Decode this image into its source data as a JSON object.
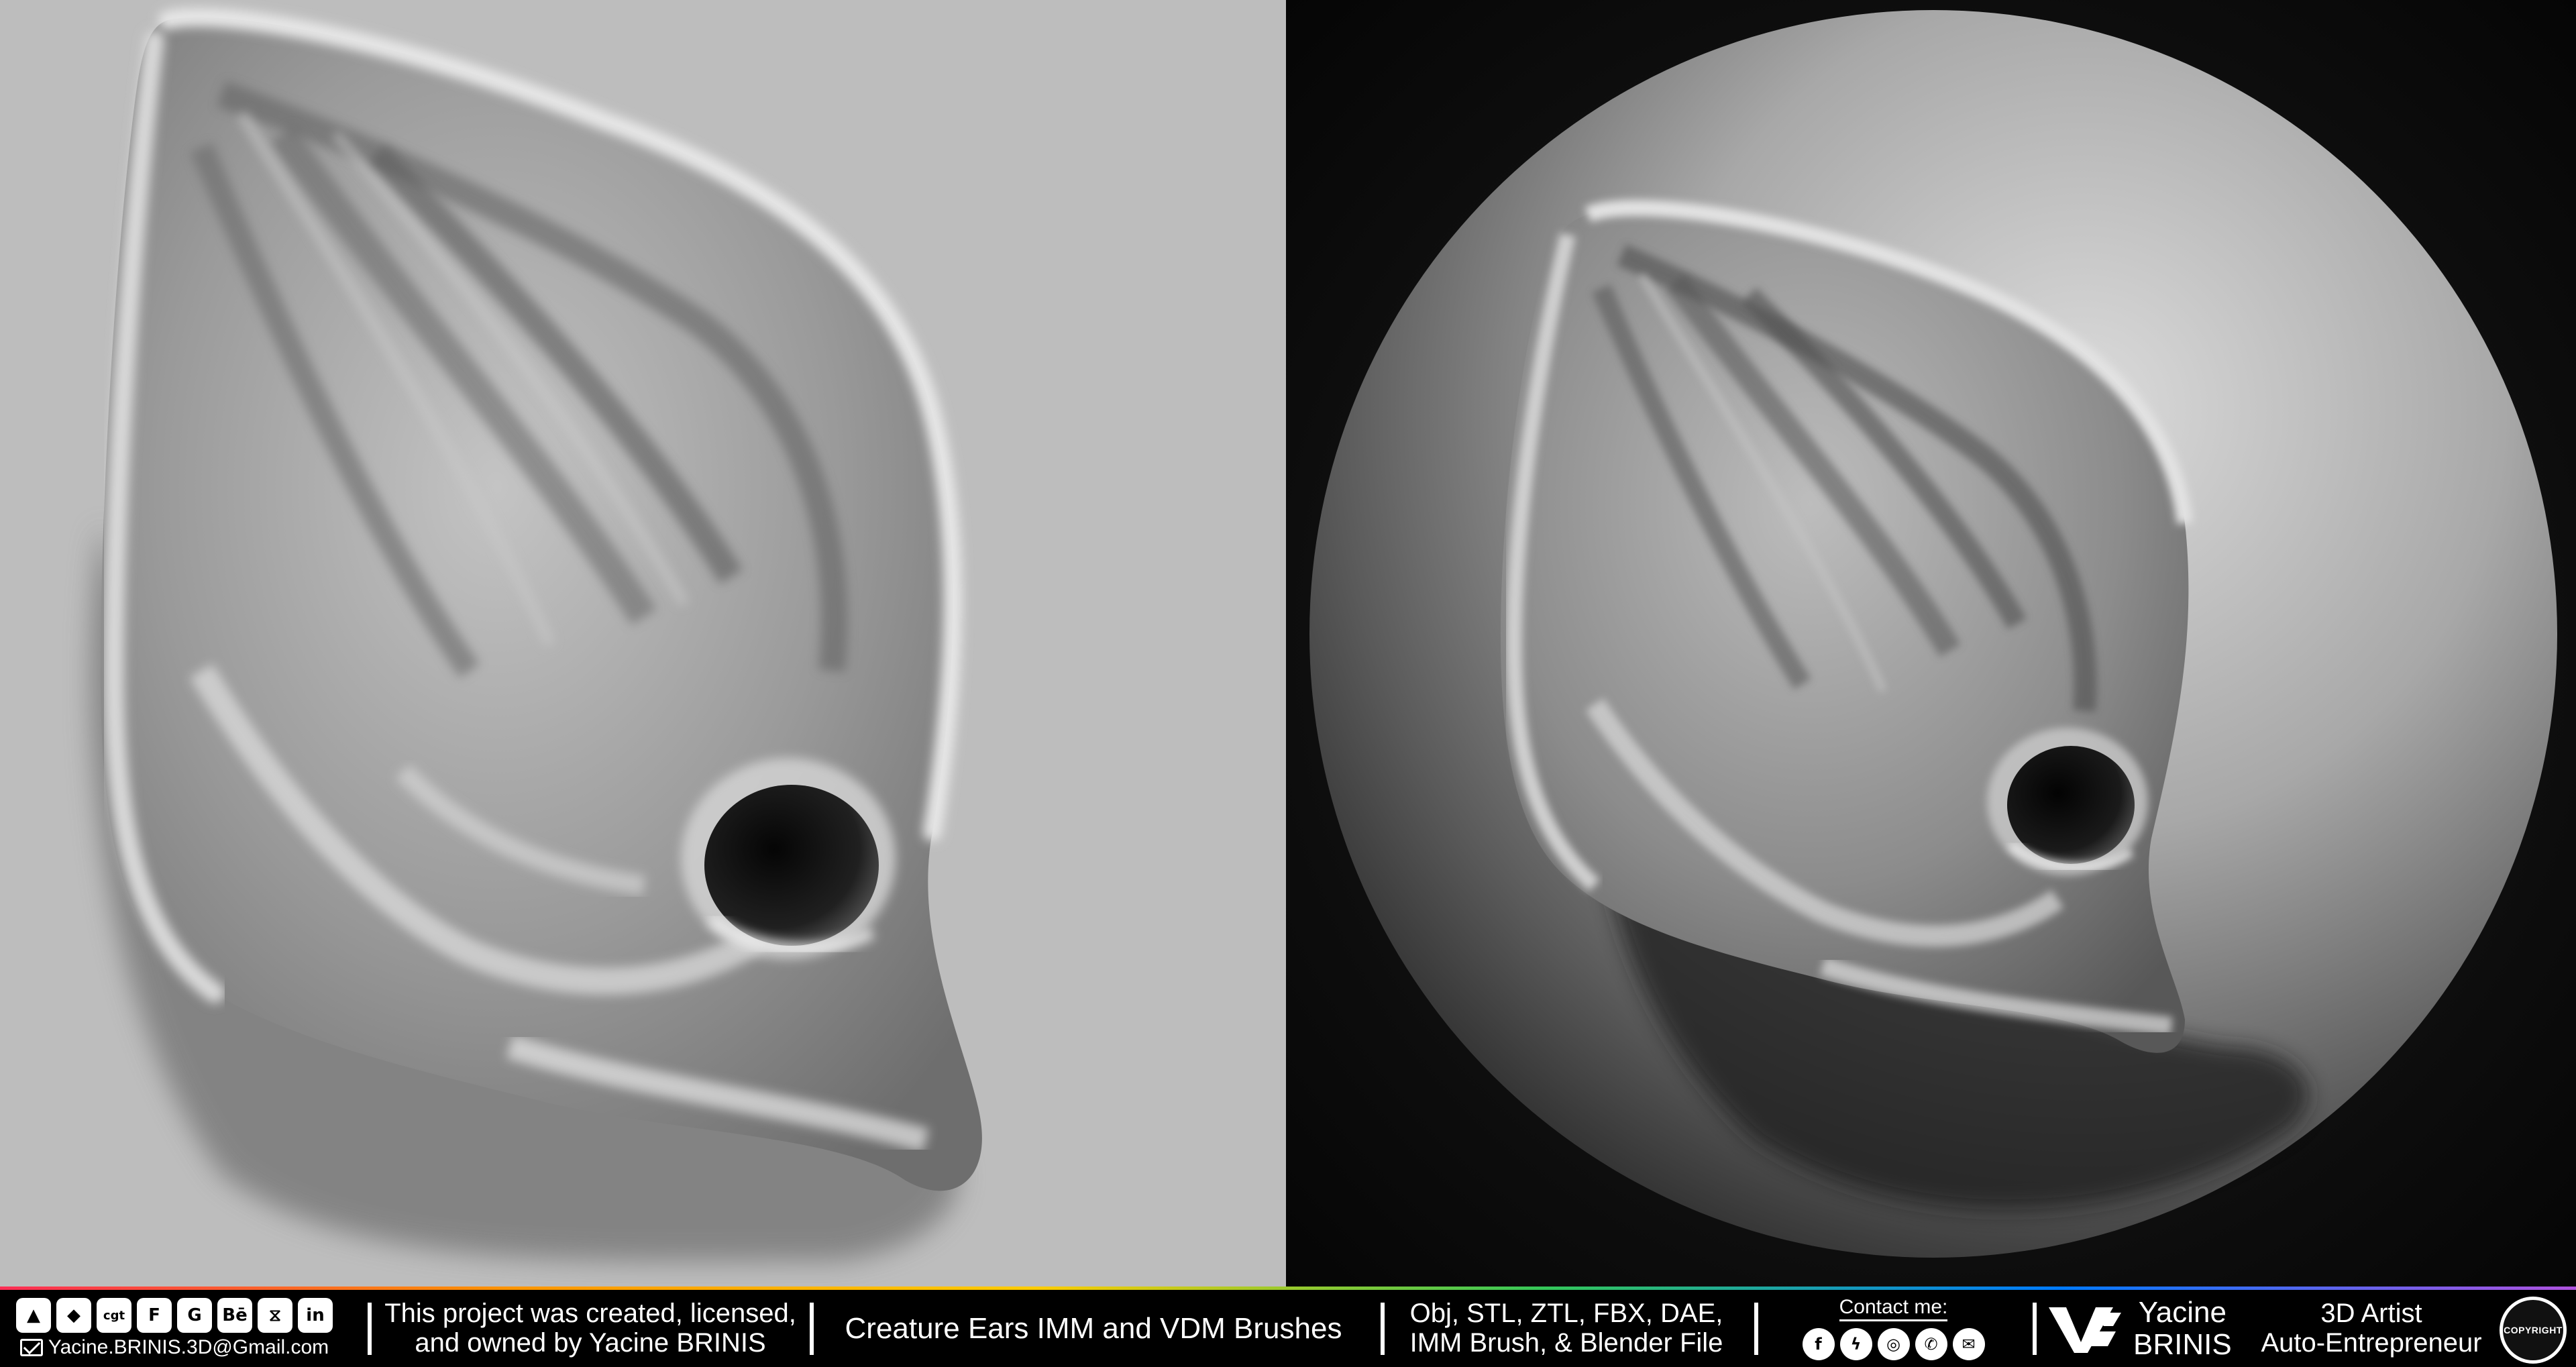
{
  "footer": {
    "email": "Yacine.BRINIS.3D@Gmail.com",
    "platform_icons": [
      {
        "name": "artstation-icon",
        "glyph": "▲"
      },
      {
        "name": "sketchfab-icon",
        "glyph": "◆"
      },
      {
        "name": "cgtrader-icon",
        "glyph": "cgt"
      },
      {
        "name": "flippednormals-icon",
        "glyph": "F"
      },
      {
        "name": "gumroad-icon",
        "glyph": "G"
      },
      {
        "name": "behance-icon",
        "glyph": "Bē"
      },
      {
        "name": "turbosquid-icon",
        "glyph": "⧖"
      },
      {
        "name": "linkedin-icon",
        "glyph": "in"
      }
    ],
    "ownership_line1": "This project was created, licensed,",
    "ownership_line2": "and owned by Yacine BRINIS",
    "product_title": "Creature Ears IMM and VDM Brushes",
    "formats_line1": "Obj, STL, ZTL, FBX, DAE,",
    "formats_line2": "IMM Brush, & Blender File",
    "contact_label": "Contact me:",
    "contact_icons": [
      {
        "name": "facebook-icon",
        "glyph": "f"
      },
      {
        "name": "messenger-icon",
        "glyph": "ϟ"
      },
      {
        "name": "instagram-icon",
        "glyph": "◎"
      },
      {
        "name": "whatsapp-icon",
        "glyph": "✆"
      },
      {
        "name": "email-icon",
        "glyph": "✉"
      }
    ],
    "brand_first": "Yacine",
    "brand_last": "BRINIS",
    "role_line1": "3D Artist",
    "role_line2": "Auto-Entrepreneur",
    "copyright_badge": "COPYRIGHT",
    "stripe_colors": [
      "#ff2d55",
      "#ff9500",
      "#ffcc00",
      "#34c759",
      "#007aff",
      "#af52de"
    ]
  }
}
